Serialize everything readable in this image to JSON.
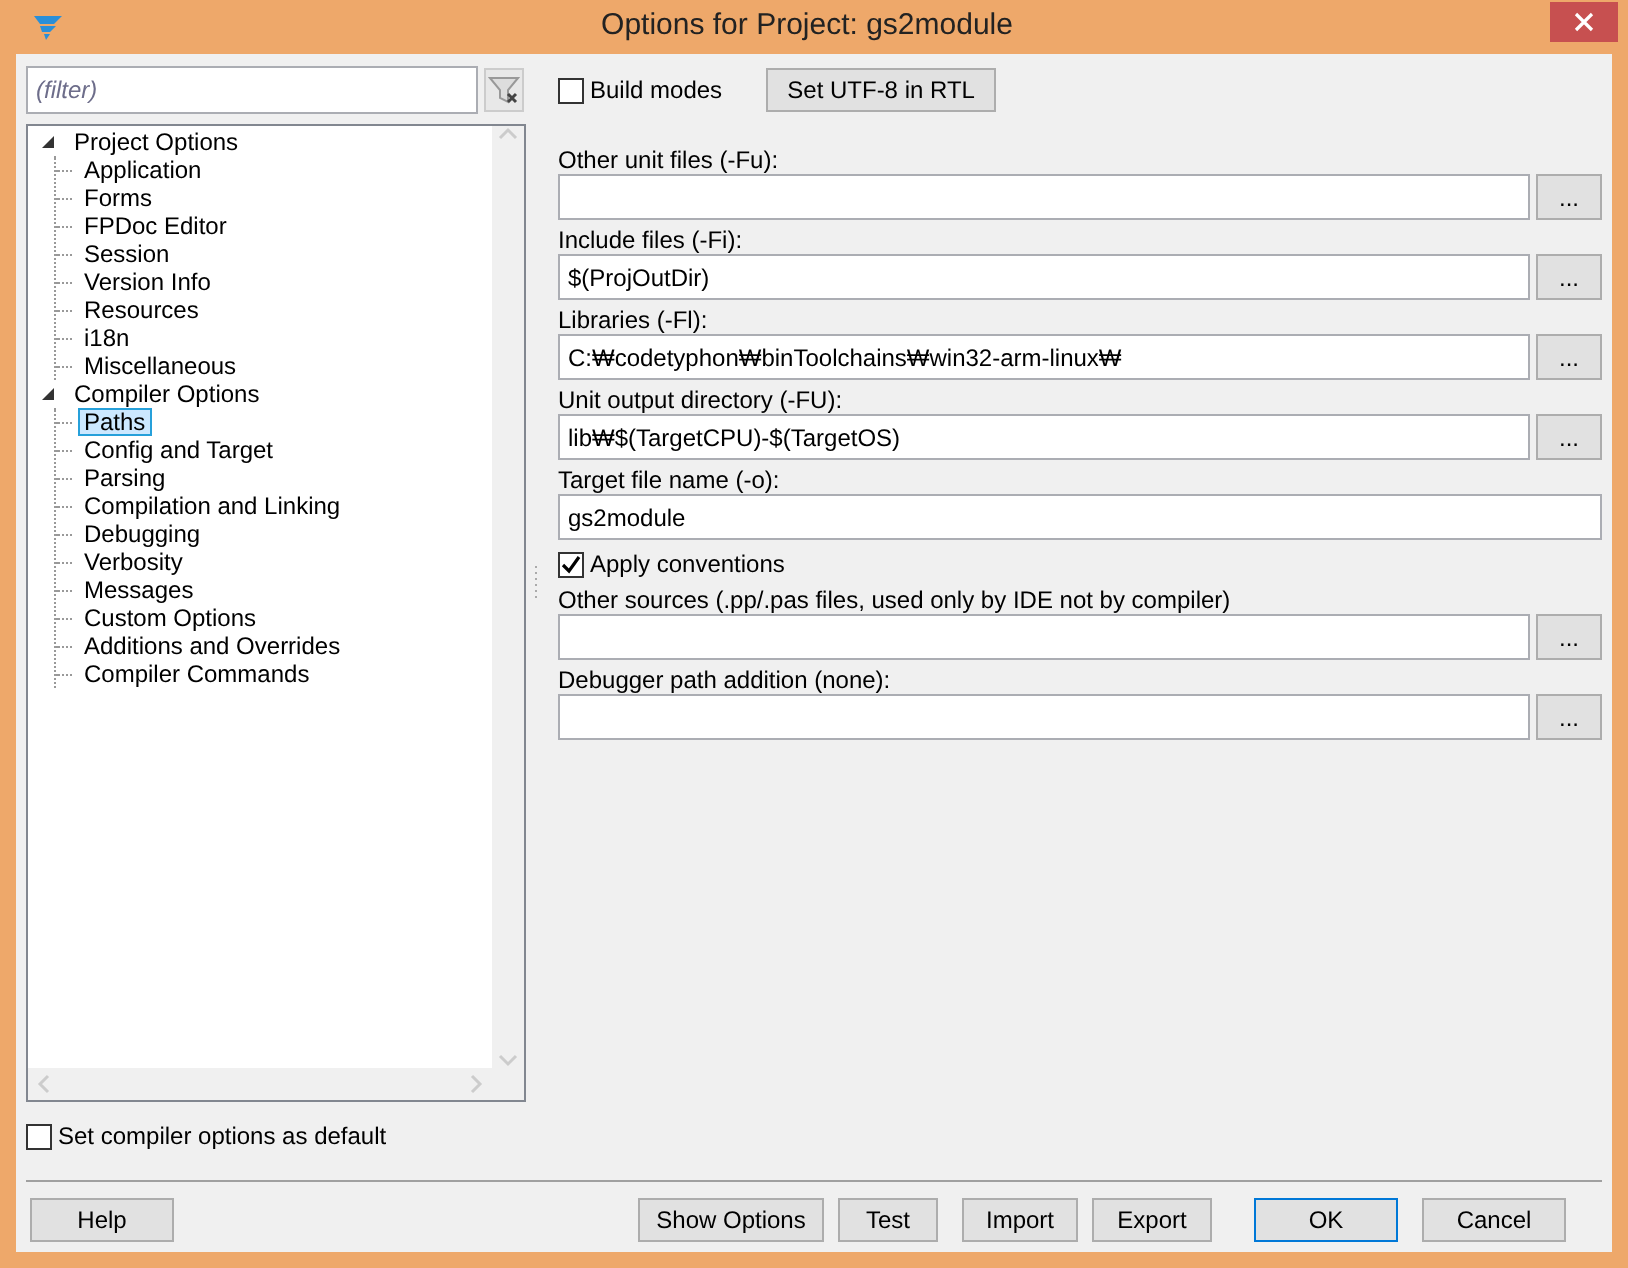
{
  "window": {
    "title": "Options for Project: gs2module"
  },
  "filter": {
    "placeholder": "(filter)"
  },
  "tree": [
    {
      "label": "Project Options",
      "expanded": true,
      "selected": false,
      "children": [
        {
          "label": "Application",
          "selected": false
        },
        {
          "label": "Forms",
          "selected": false
        },
        {
          "label": "FPDoc Editor",
          "selected": false
        },
        {
          "label": "Session",
          "selected": false
        },
        {
          "label": "Version Info",
          "selected": false
        },
        {
          "label": "Resources",
          "selected": false
        },
        {
          "label": "i18n",
          "selected": false
        },
        {
          "label": "Miscellaneous",
          "selected": false
        }
      ]
    },
    {
      "label": "Compiler Options",
      "expanded": true,
      "selected": false,
      "children": [
        {
          "label": "Paths",
          "selected": true
        },
        {
          "label": "Config and Target",
          "selected": false
        },
        {
          "label": "Parsing",
          "selected": false
        },
        {
          "label": "Compilation and Linking",
          "selected": false
        },
        {
          "label": "Debugging",
          "selected": false
        },
        {
          "label": "Verbosity",
          "selected": false
        },
        {
          "label": "Messages",
          "selected": false
        },
        {
          "label": "Custom Options",
          "selected": false
        },
        {
          "label": "Additions and Overrides",
          "selected": false
        },
        {
          "label": "Compiler Commands",
          "selected": false
        }
      ]
    }
  ],
  "default_checkbox": {
    "label": "Set compiler options as default",
    "checked": false
  },
  "top_bar": {
    "build_modes": {
      "label": "Build modes",
      "checked": false
    },
    "button": "Set UTF-8 in RTL"
  },
  "fields": [
    {
      "kind": "path",
      "label": "Other unit files (-Fu):",
      "button": "..."
    },
    {
      "kind": "path",
      "label": "Include files (-Fi):",
      "value": "$(ProjOutDir)",
      "button": "..."
    },
    {
      "kind": "path",
      "label": "Libraries (-Fl):",
      "value": "C:₩codetyphon₩binToolchains₩win32-arm-linux₩",
      "button": "..."
    },
    {
      "kind": "path",
      "label": "Unit output directory (-FU):",
      "value": "lib₩$(TargetCPU)-$(TargetOS)",
      "button": "..."
    },
    {
      "kind": "text",
      "label": "Target file name (-o):",
      "value": "gs2module"
    },
    {
      "kind": "checkbox",
      "label": "Apply conventions",
      "checked": true
    },
    {
      "kind": "path",
      "label": "Other sources (.pp/.pas files, used only by IDE not by compiler)",
      "button": "..."
    },
    {
      "kind": "path",
      "label": "Debugger path addition (none):",
      "button": "..."
    }
  ],
  "buttons": [
    {
      "label": "Help",
      "default": false
    },
    {
      "label": "Show Options",
      "default": false
    },
    {
      "label": "Test",
      "default": false
    },
    {
      "label": "Import",
      "default": false
    },
    {
      "label": "Export",
      "default": false
    },
    {
      "label": "OK",
      "default": true
    },
    {
      "label": "Cancel",
      "default": false
    }
  ]
}
